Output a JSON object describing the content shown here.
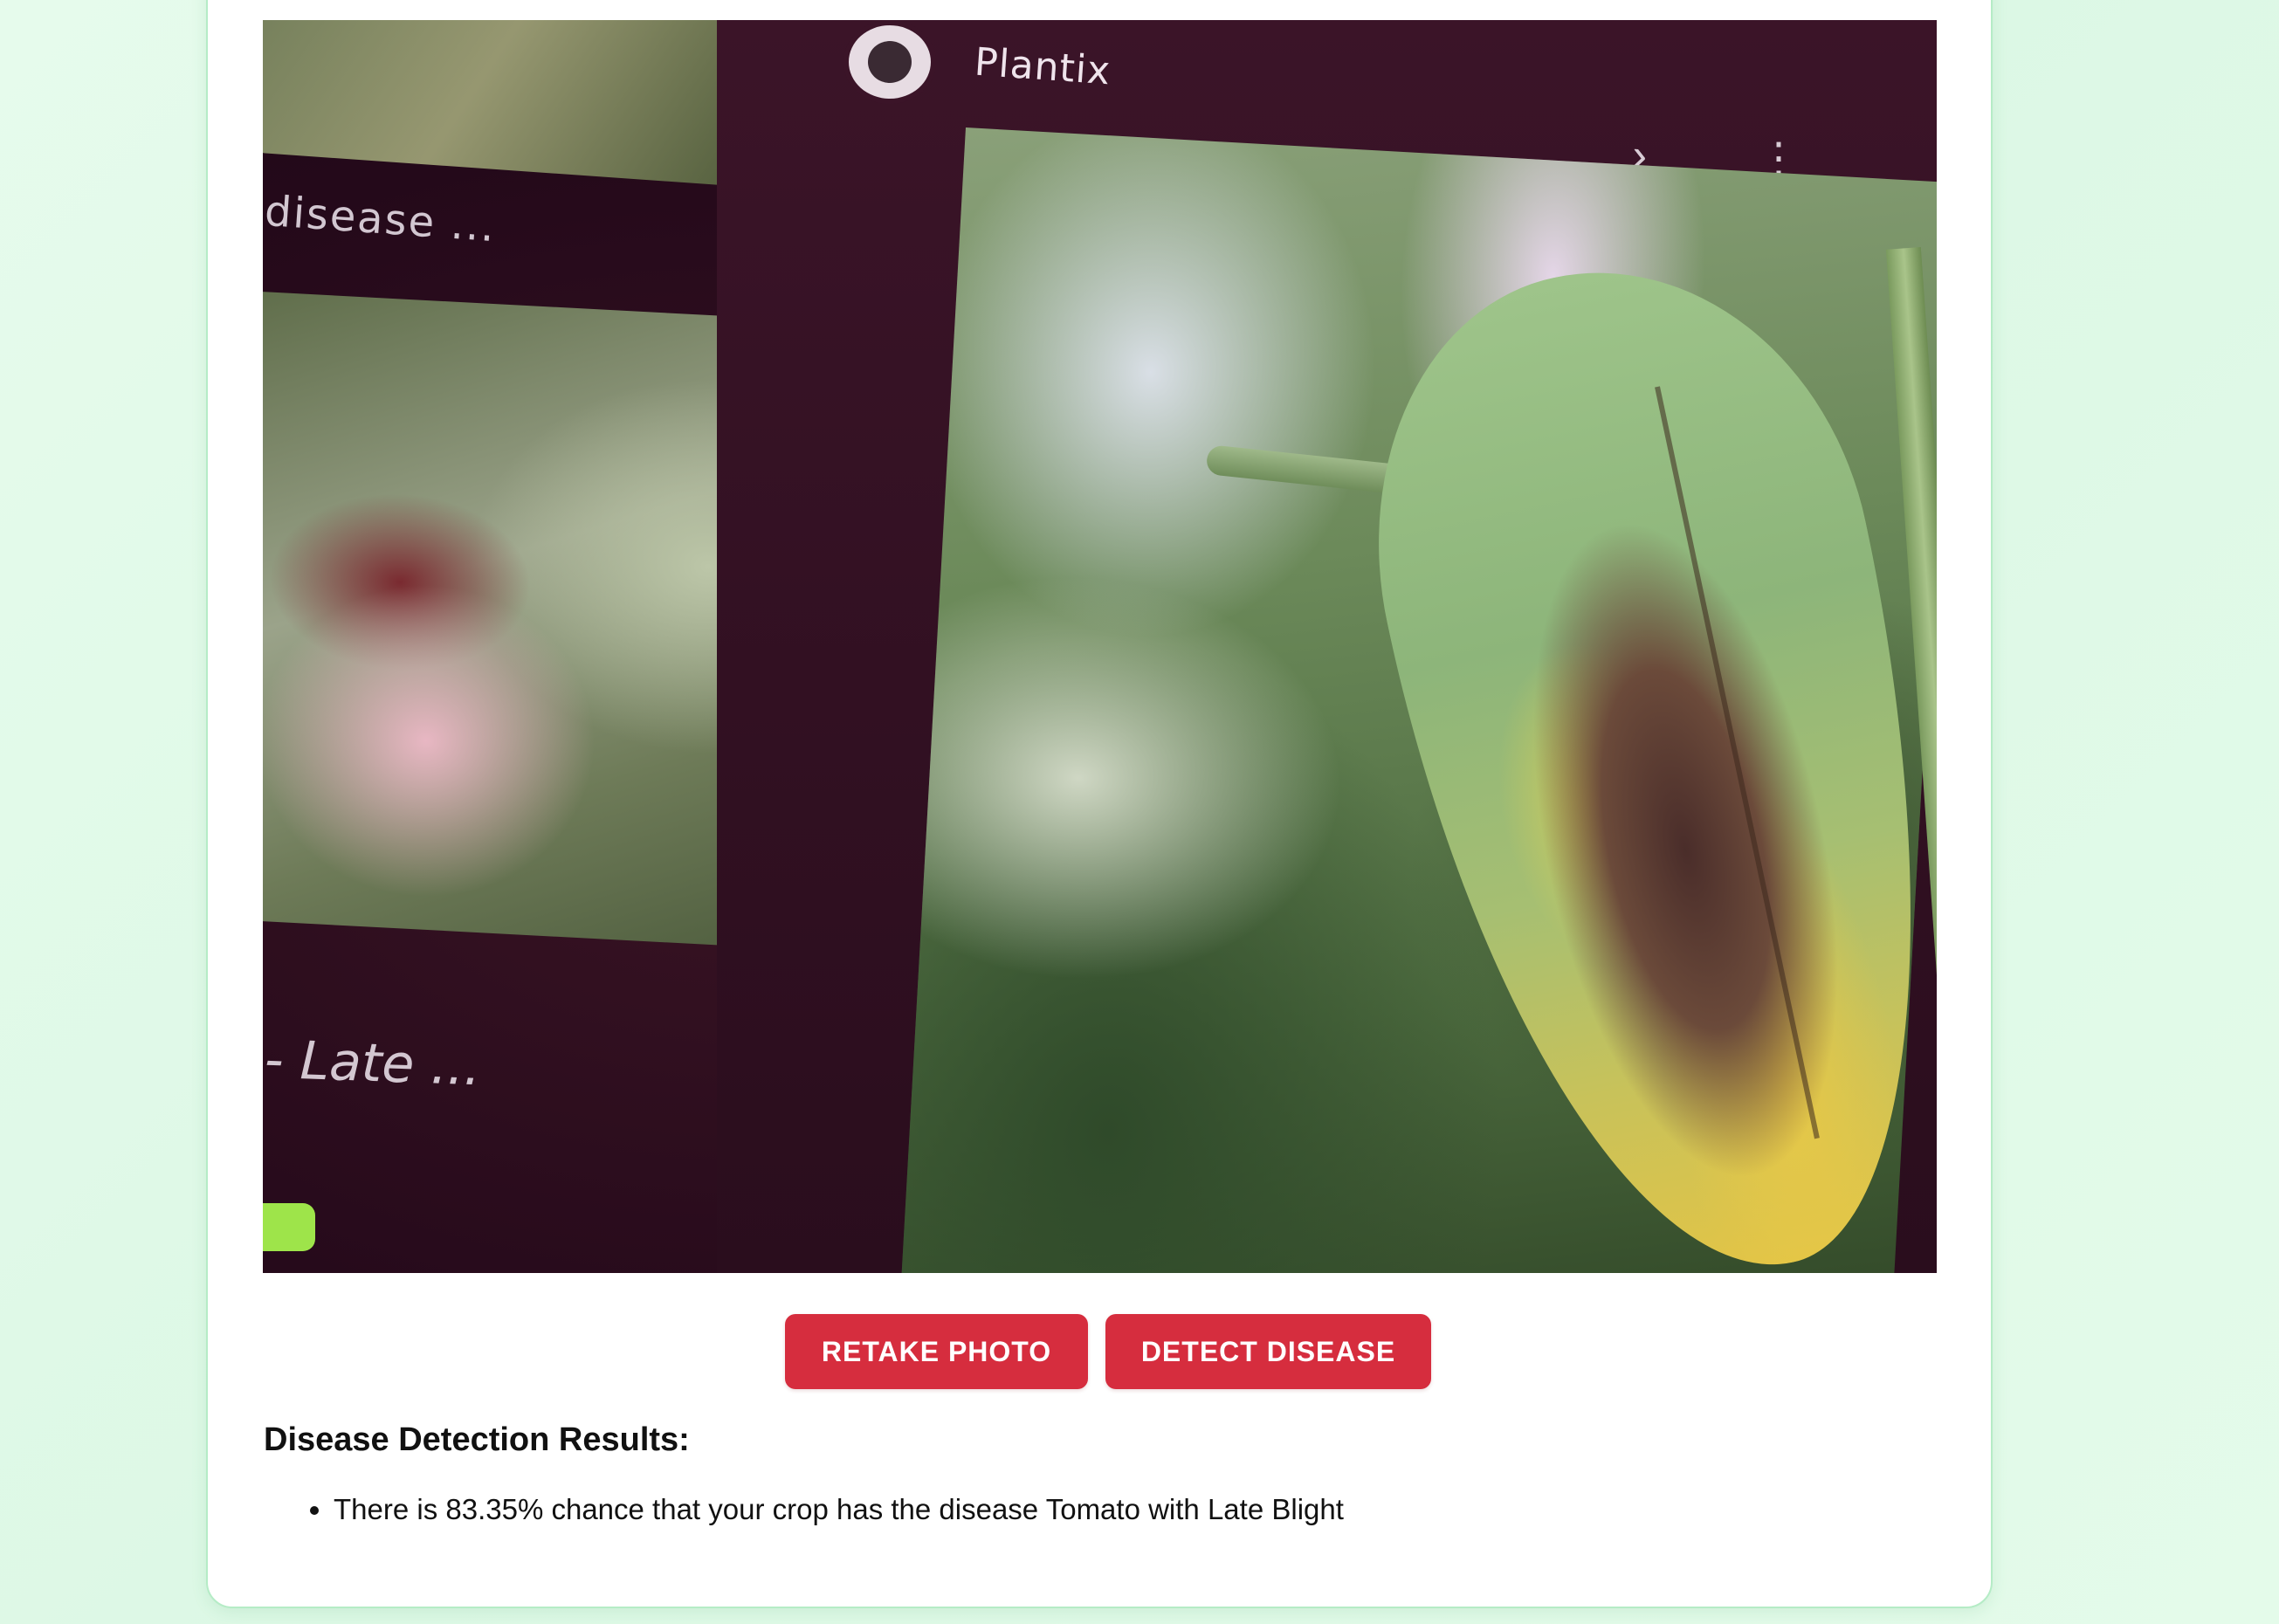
{
  "photo": {
    "overlay_texts": {
      "disease_snippet": "disease ...",
      "late_snippet": "- Late ...",
      "app_name": "Plantix"
    },
    "icons": [
      "plantix-logo-icon",
      "chevron-right-icon",
      "more-vert-icon",
      "close-icon"
    ]
  },
  "actions": {
    "retake_label": "RETAKE PHOTO",
    "detect_label": "DETECT DISEASE"
  },
  "results": {
    "title": "Disease Detection Results:",
    "items": [
      "There is 83.35% chance that your crop has the disease Tomato with Late Blight"
    ]
  },
  "colors": {
    "background": "#e2f9e9",
    "card_border": "#b5ecc6",
    "button": "#d62d3e",
    "button_text": "#ffffff",
    "text": "#111111"
  }
}
